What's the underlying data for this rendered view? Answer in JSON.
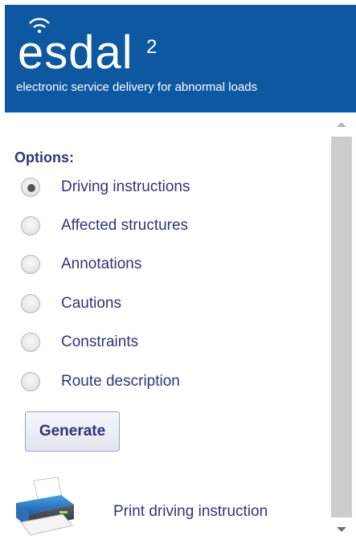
{
  "header": {
    "logo_text": "esdal",
    "logo_superscript": "2",
    "tagline": "electronic service delivery for abnormal loads",
    "brand_color": "#0d58a1"
  },
  "options": {
    "title": "Options:",
    "items": [
      {
        "label": "Driving instructions",
        "checked": true
      },
      {
        "label": "Affected structures",
        "checked": false
      },
      {
        "label": "Annotations",
        "checked": false
      },
      {
        "label": "Cautions",
        "checked": false
      },
      {
        "label": "Constraints",
        "checked": false
      },
      {
        "label": "Route description",
        "checked": false
      }
    ]
  },
  "actions": {
    "generate_label": "Generate",
    "print_label": "Print driving instruction",
    "print_icon": "printer-icon"
  },
  "colors": {
    "text": "#33337a",
    "scrollbar_thumb": "#cdcdcd"
  }
}
